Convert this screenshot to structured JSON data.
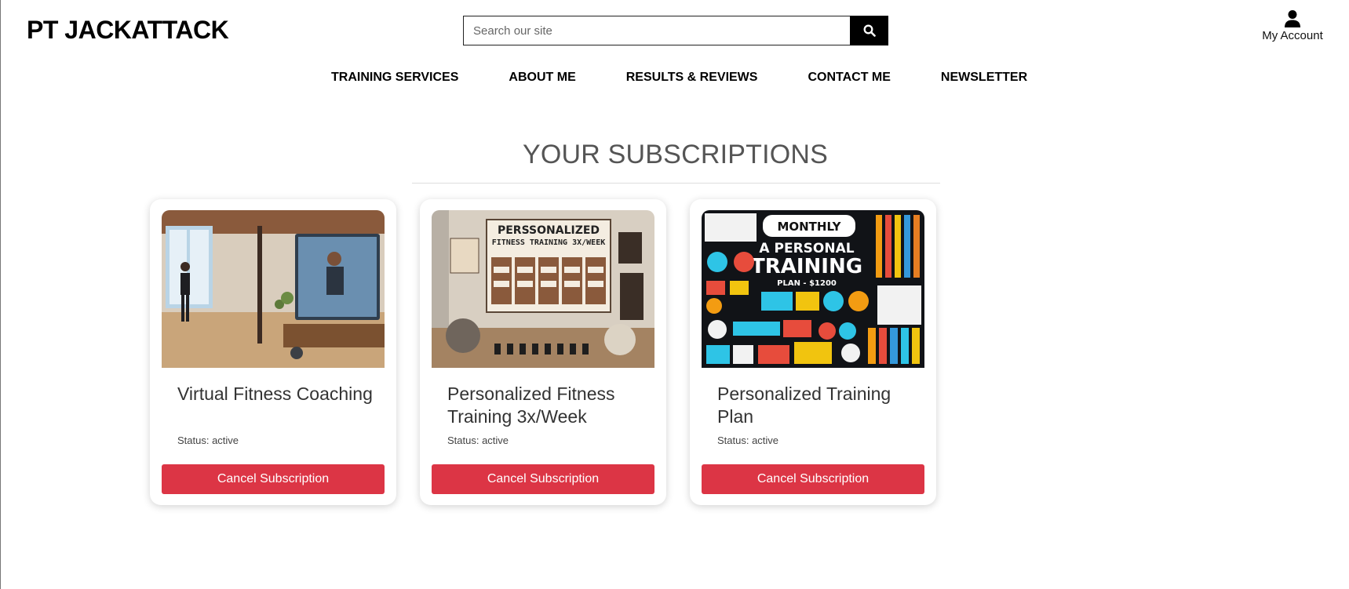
{
  "brand": "PT JACKATTACK",
  "search": {
    "placeholder": "Search our site",
    "value": ""
  },
  "account": {
    "label": "My Account"
  },
  "nav": [
    "TRAINING SERVICES",
    "ABOUT ME",
    "RESULTS & REVIEWS",
    "CONTACT ME",
    "NEWSLETTER"
  ],
  "page_title": "YOUR SUBSCRIPTIONS",
  "subscriptions": [
    {
      "title": "Virtual Fitness Coaching",
      "status": "Status: active",
      "button": "Cancel Subscription",
      "image": "home-workout-video-call-image"
    },
    {
      "title": "Personalized Fitness Training 3x/Week",
      "status": "Status: active",
      "button": "Cancel Subscription",
      "image": "gym-schedule-board-image",
      "image_text": [
        "PERSSONALIZED",
        "FITNESS TRAINING 3X/WEEK"
      ]
    },
    {
      "title": "Personalized Training Plan",
      "status": "Status: active",
      "button": "Cancel Subscription",
      "image": "monthly-training-plan-infographic-image",
      "image_text": [
        "MONTHLY",
        "A PERSONAL",
        "TRAINING",
        "PLAN - $1200"
      ]
    }
  ],
  "colors": {
    "danger": "#dc3545",
    "text": "#333333",
    "title": "#555555"
  }
}
